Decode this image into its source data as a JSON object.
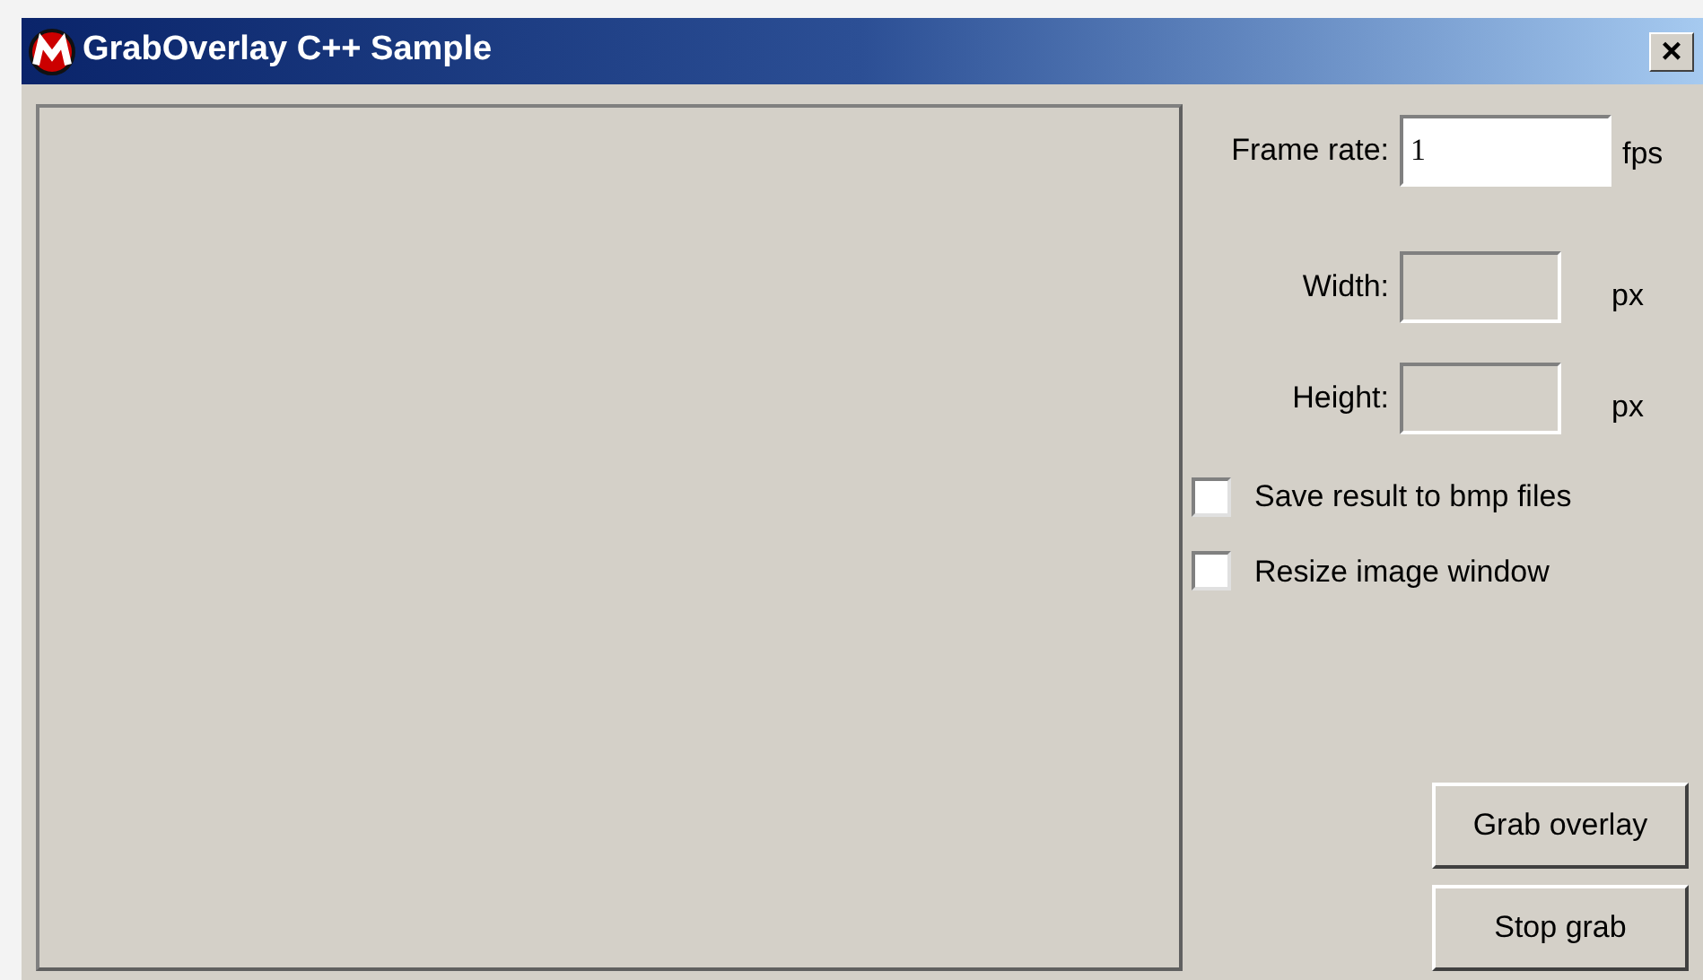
{
  "window": {
    "title": "GrabOverlay C++ Sample",
    "close": "×"
  },
  "fields": [
    {
      "label": "Frame rate:",
      "value": "1",
      "unit": "fps",
      "disabled": false
    },
    {
      "label": "Width:",
      "unit": "px",
      "disabled": true
    },
    {
      "label": "Height:",
      "unit": "px",
      "disabled": true
    }
  ],
  "checkboxes": [
    {
      "label": "Save result to bmp files",
      "checked": false
    },
    {
      "label": "Resize image window",
      "checked": false
    }
  ],
  "buttons": [
    "Grab overlay",
    "Stop grab"
  ]
}
